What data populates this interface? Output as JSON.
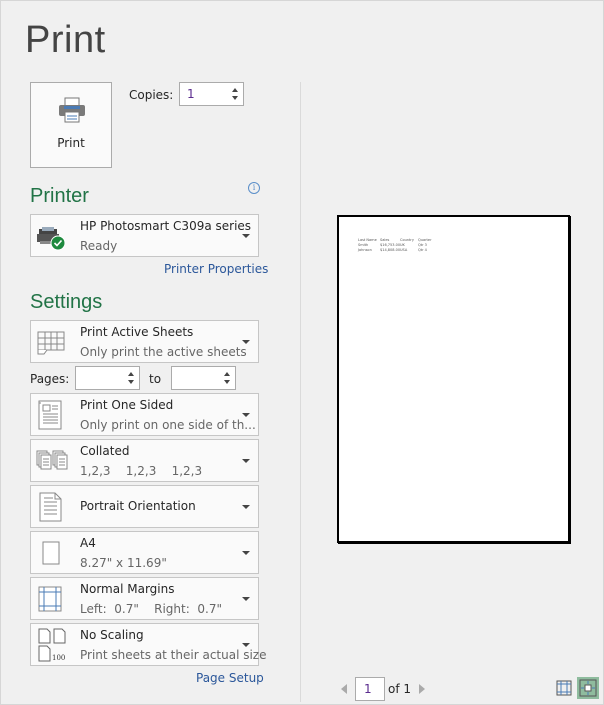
{
  "title": "Print",
  "print_button": {
    "label": "Print",
    "icon": "printer-icon"
  },
  "copies": {
    "label": "Copies:",
    "value": "1"
  },
  "printer": {
    "section_title": "Printer",
    "info_icon": "i",
    "name": "HP Photosmart C309a series",
    "status": "Ready",
    "properties_link": "Printer Properties"
  },
  "settings": {
    "section_title": "Settings",
    "what": {
      "title": "Print Active Sheets",
      "subtitle": "Only print the active sheets"
    },
    "pages": {
      "label": "Pages:",
      "from": "",
      "to_label": "to",
      "to": ""
    },
    "sides": {
      "title": "Print One Sided",
      "subtitle": "Only print on one side of th..."
    },
    "collation": {
      "title": "Collated",
      "subtitle": "1,2,3    1,2,3    1,2,3"
    },
    "orientation": {
      "title": "Portrait Orientation"
    },
    "paper": {
      "title": "A4",
      "subtitle": "8.27\" x 11.69\""
    },
    "margins": {
      "title": "Normal Margins",
      "subtitle": "Left:  0.7\"    Right:  0.7\""
    },
    "scaling": {
      "title": "No Scaling",
      "subtitle": "Print sheets at their actual size",
      "icon_badge": "100"
    },
    "page_setup_link": "Page Setup"
  },
  "preview": {
    "rows": [
      [
        "Last Name",
        "Sales",
        "Country",
        "Quarter"
      ],
      [
        "Smith",
        "$16,753.00",
        "UK",
        "Qtr 3"
      ],
      [
        "Johnson",
        "$14,808.00",
        "USA",
        "Qtr 4"
      ]
    ],
    "current_page": "1",
    "of_label": "of 1"
  },
  "colors": {
    "accent": "#217346",
    "link": "#2b579a",
    "active_view": "#8fbc9e"
  }
}
